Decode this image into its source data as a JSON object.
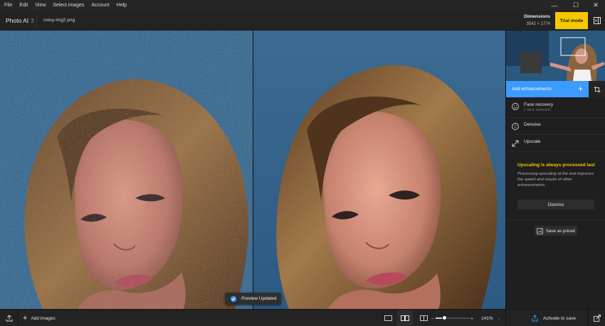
{
  "menu": [
    "File",
    "Edit",
    "View",
    "Select images",
    "Account",
    "Help"
  ],
  "window_controls": {
    "minimize": "—",
    "maximize": "☐",
    "close": "✕"
  },
  "app": {
    "name": "Photo AI",
    "version": "3"
  },
  "file": {
    "name": "noisy-img2.png"
  },
  "dimensions": {
    "label": "Dimensions",
    "value": "3542 × 1774"
  },
  "trial": {
    "label": "Trial mode"
  },
  "preview": {
    "toast": "Preview Updated"
  },
  "panel": {
    "add_enhancements": "Add enhancements",
    "items": [
      {
        "label": "Face recovery",
        "sub": "1 face selected",
        "icon": "face-icon"
      },
      {
        "label": "Denoise",
        "sub": "",
        "icon": "denoise-icon"
      },
      {
        "label": "Upscale",
        "sub": "",
        "icon": "upscale-icon"
      }
    ],
    "notice_title": "Upscaling is always processed last",
    "notice_body": "Processing upscaling at the end improves the speed and results of other enhancements.",
    "dismiss": "Dismiss",
    "save_preset": "Save as preset"
  },
  "bottom": {
    "add_images": "Add images",
    "zoom": "141%",
    "zoom_level": 0.25,
    "activate": "Activate to save"
  },
  "colors": {
    "accent": "#3d9bff",
    "trial": "#f5c800",
    "backdrop": "#2f5f87"
  }
}
